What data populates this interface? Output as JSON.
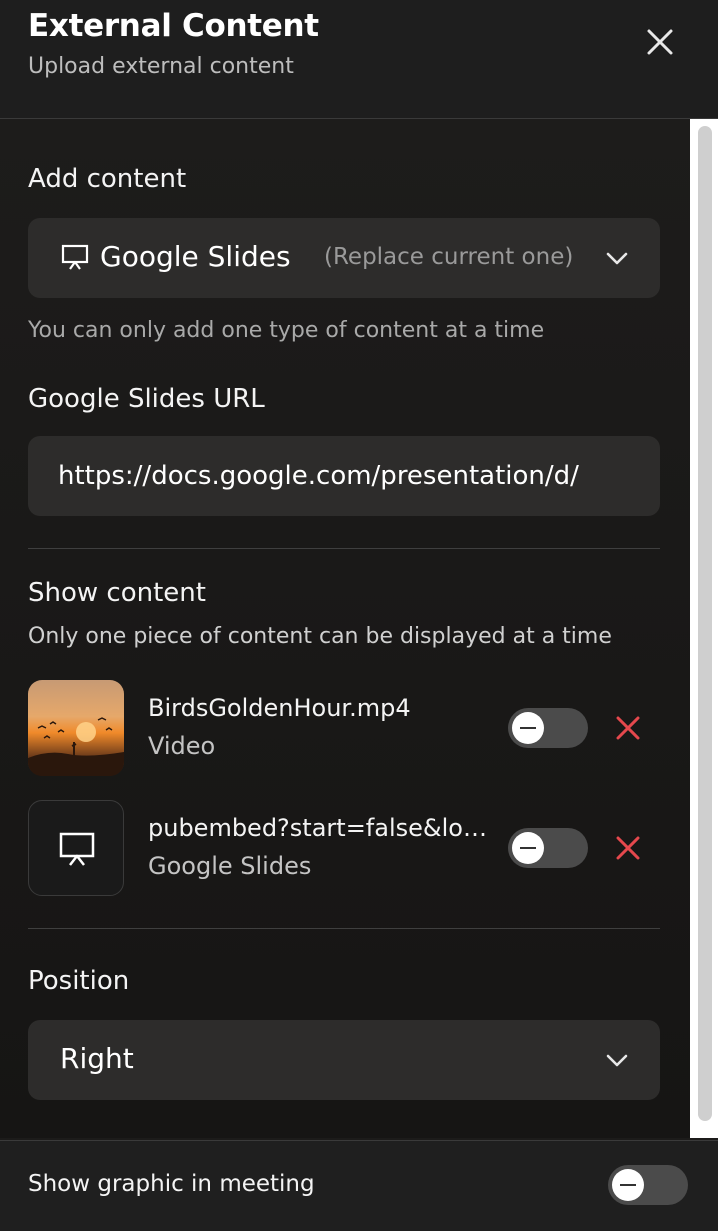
{
  "header": {
    "title": "External Content",
    "subtitle": "Upload external content",
    "close_icon": "close-icon"
  },
  "add_content": {
    "label": "Add content",
    "selected_type": "Google Slides",
    "selected_note": "(Replace current one)",
    "type_icon": "presentation-icon",
    "hint": "You can only add one type of content at a time"
  },
  "url": {
    "label": "Google Slides URL",
    "value": "https://docs.google.com/presentation/d/"
  },
  "show_content": {
    "label": "Show content",
    "hint": "Only one piece of content can be displayed at a time",
    "items": [
      {
        "name": "BirdsGoldenHour.mp4",
        "type": "Video",
        "enabled": false
      },
      {
        "name": "pubembed?start=false&loo…",
        "type": "Google Slides",
        "enabled": false
      }
    ]
  },
  "position": {
    "label": "Position",
    "value": "Right"
  },
  "footer": {
    "label": "Show graphic in meeting",
    "enabled": false
  },
  "colors": {
    "remove": "#e5484d",
    "background": "#1c1b1a",
    "field": "#2d2c2b"
  }
}
